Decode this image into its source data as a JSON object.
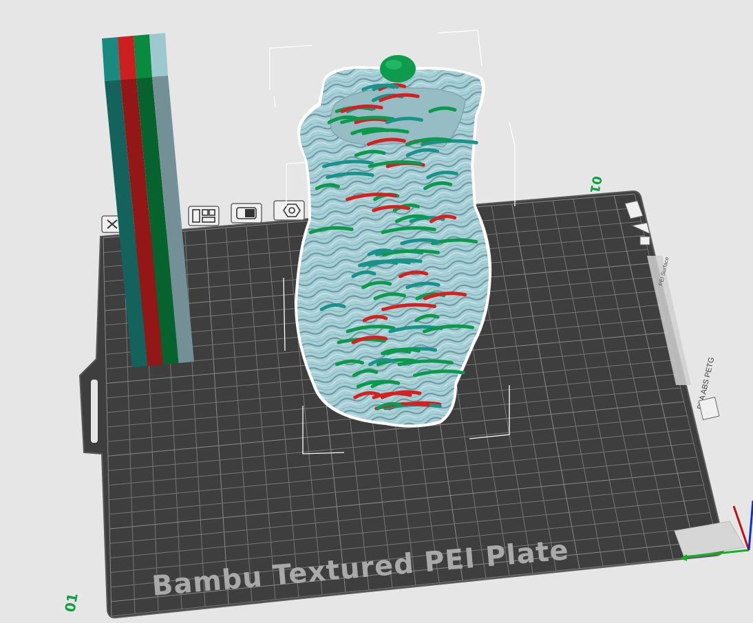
{
  "viewport": {
    "plate_name": "Bambu Textured PEI Plate",
    "plate_number_front": "01",
    "plate_number_back": "01",
    "plate_side_label": "PLA ABS PETG",
    "plate_side_small_label": "PEI Surface",
    "plate_tools": [
      "delete-plate-icon",
      "arrange-icon",
      "orient-icon",
      "plate-settings-icon"
    ]
  },
  "wipe_tower": {
    "colors": [
      "#1a8a80",
      "#cc2020",
      "#0a8a40",
      "#9ec8d0"
    ]
  },
  "model": {
    "name": "Rope vase",
    "base_color": "#a7cfd6",
    "accent_colors": [
      "#d62020",
      "#0b9a4c",
      "#19938a"
    ]
  },
  "colors": {
    "background": "#e6e6e6",
    "plate": "#3e3e3e",
    "grid_line": "#707070",
    "axis_x": "#10b020",
    "axis_y": "#1030c0",
    "axis_z": "#c01010"
  }
}
